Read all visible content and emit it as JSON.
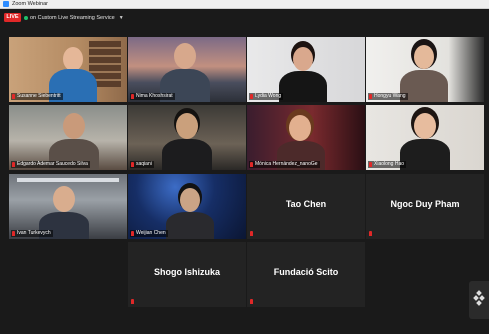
{
  "window": {
    "title": "Zoom Webinar"
  },
  "topbar": {
    "live_label": "LIVE",
    "stream_label": "on Custom Live Streaming Service"
  },
  "participants": [
    {
      "name": "Susanne Siebentritt"
    },
    {
      "name": "Nima Khoshsirat"
    },
    {
      "name": "Lydia Wong"
    },
    {
      "name": "Hongyu Wang"
    },
    {
      "name": "Edgardo Ademar Saucedo Silva"
    },
    {
      "name": "saqiani"
    },
    {
      "name": "Mónica Hernández_nanoGe"
    },
    {
      "name": "Xiaolong Hao"
    },
    {
      "name": "Ivan Turkevych"
    },
    {
      "name": "Weijian Chen"
    },
    {
      "name": "Tao Chen"
    },
    {
      "name": "Ngoc Duy Pham"
    },
    {
      "name": "Shogo Ishizuka"
    },
    {
      "name": "Fundació Scito"
    }
  ],
  "colors": {
    "live": "#e02828",
    "active_speaker": "#b7d43a",
    "background": "#1a1a1a"
  }
}
